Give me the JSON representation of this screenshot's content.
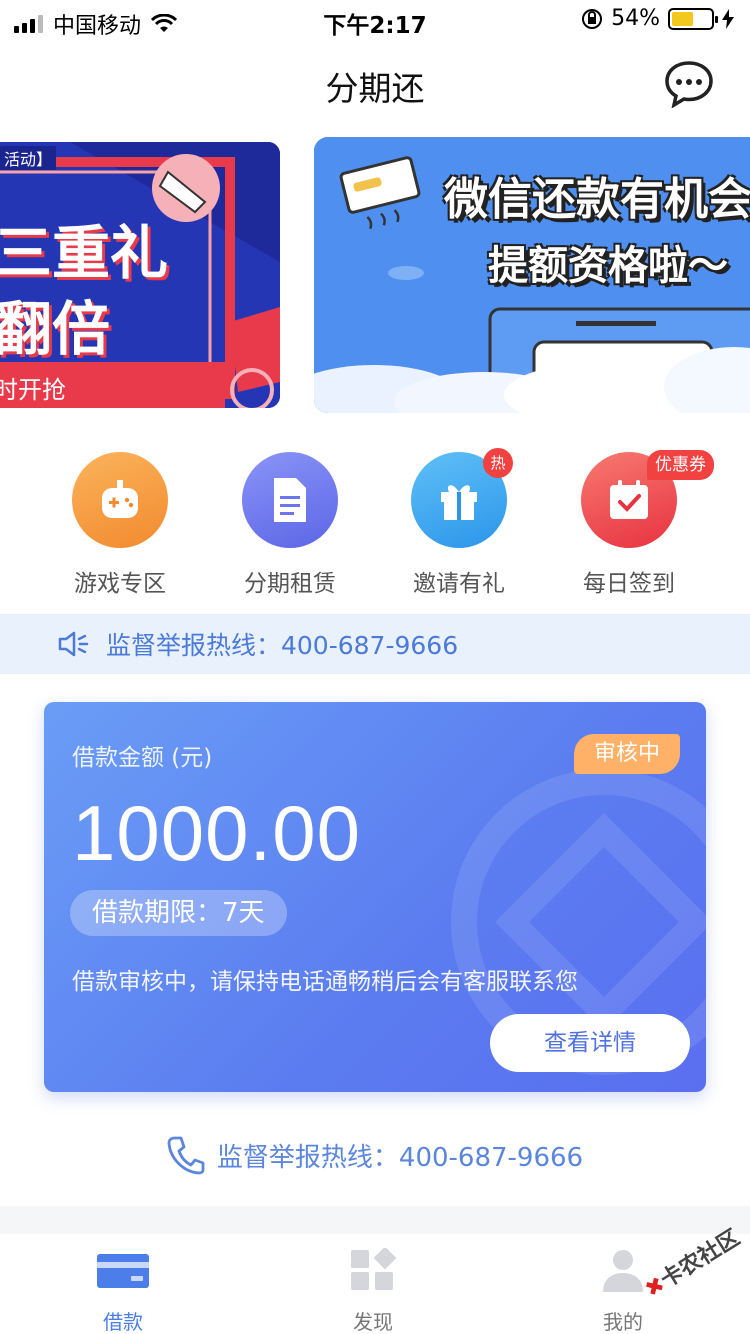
{
  "status_bar": {
    "carrier": "中国移动",
    "time": "下午2:17",
    "battery_percent": "54%",
    "battery_level": 0.54
  },
  "nav": {
    "title": "分期还",
    "chat_icon": "chat-bubble-icon"
  },
  "banners": {
    "left": {
      "tag": "活动】",
      "line1": "三重礼",
      "line2": "翻倍",
      "line3": "时开抢"
    },
    "right": {
      "line1": "微信还款有机会",
      "line2": "提额资格啦～"
    }
  },
  "quick_menu": [
    {
      "label": "游戏专区",
      "icon": "gamepad-icon",
      "color": "#f79a3e"
    },
    {
      "label": "分期租赁",
      "icon": "document-icon",
      "color": "#6b76ee"
    },
    {
      "label": "邀请有礼",
      "icon": "gift-icon",
      "color": "#38a6f2",
      "badge": "热"
    },
    {
      "label": "每日签到",
      "icon": "calendar-check-icon",
      "color": "#f0474a",
      "badge": "优惠券"
    }
  ],
  "notice": {
    "text": "监督举报热线：400-687-9666",
    "icon": "speaker-icon"
  },
  "loan": {
    "label": "借款金额 (元)",
    "status": "审核中",
    "amount": "1000.00",
    "term": "借款期限：7天",
    "desc": "借款审核中，请保持电话通畅稍后会有客服联系您",
    "detail_button": "查看详情"
  },
  "hotline": {
    "text": "监督举报热线：400-687-9666",
    "icon": "phone-icon"
  },
  "tab_bar": [
    {
      "label": "借款",
      "icon": "card-icon",
      "active": true
    },
    {
      "label": "发现",
      "icon": "discover-icon",
      "active": false
    },
    {
      "label": "我的",
      "icon": "user-icon",
      "active": false
    }
  ],
  "watermark": "卡农社区",
  "colors": {
    "accent": "#4b7ee8",
    "status_badge": "#ffb168",
    "notice_bg": "#e9f1fd"
  }
}
